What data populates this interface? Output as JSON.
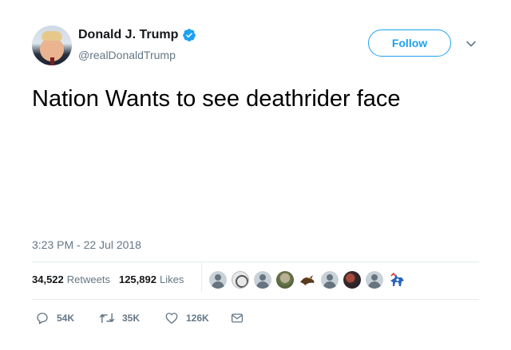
{
  "header": {
    "display_name": "Donald J. Trump",
    "handle": "@realDonaldTrump",
    "verified_icon": "verified-badge-icon",
    "follow_label": "Follow",
    "more_icon": "chevron-down-icon"
  },
  "tweet": {
    "text": "Nation Wants to see deathrider face",
    "timestamp": "3:23 PM - 22 Jul 2018"
  },
  "stats": {
    "retweets_count": "34,522",
    "retweets_label": "Retweets",
    "likes_count": "125,892",
    "likes_label": "Likes"
  },
  "actions": {
    "reply_count": "54K",
    "retweet_count": "35K",
    "like_count": "126K"
  },
  "colors": {
    "accent": "#1da1f2",
    "secondary_text": "#657786",
    "divider": "#e6ecf0"
  }
}
